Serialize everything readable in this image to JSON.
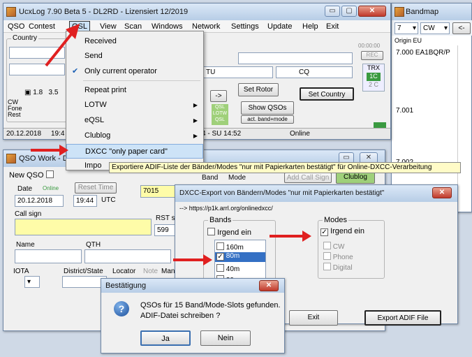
{
  "main": {
    "title": "UcxLog 7.90 Beta 5 - DL2RD - Lizensiert 12/2019",
    "menu": [
      "QSO",
      "Contest",
      "QSL",
      "View",
      "Scan",
      "Windows",
      "Network",
      "Settings",
      "Update",
      "Help",
      "Exit"
    ],
    "country_label": "Country",
    "time": "00:00:00",
    "rec": "REC",
    "trx": "TRX",
    "tu": "TU",
    "cq": "CQ",
    "bands": [
      "1.8",
      "3.5"
    ],
    "mode_rows": [
      "CW",
      "Fone",
      "Rest"
    ],
    "set_rotor": "Set Rotor",
    "set_country": "Set Country",
    "arrow_btn": "->",
    "show_qsos": "Show QSOs",
    "act_band_mode": "act. band+mode",
    "qsl_lotw": [
      "QSL",
      "LOTW",
      "QSL"
    ],
    "date_status": "20.12.2018",
    "time_status": "19:4",
    "sun": "4 - SU 14:52",
    "online": "Online"
  },
  "qsl_menu": {
    "items": [
      {
        "label": "Received",
        "submenu": false,
        "checked": false
      },
      {
        "label": "Send",
        "submenu": false,
        "checked": false
      },
      {
        "label": "Only current operator",
        "submenu": false,
        "checked": true
      },
      {
        "label": "Repeat print",
        "submenu": false,
        "checked": false
      },
      {
        "label": "LOTW",
        "submenu": true,
        "checked": false
      },
      {
        "label": "eQSL",
        "submenu": true,
        "checked": false
      },
      {
        "label": "Clublog",
        "submenu": true,
        "checked": false
      },
      {
        "label": "DXCC \"only paper card\"",
        "submenu": false,
        "checked": false
      },
      {
        "label": "Impo",
        "submenu": false,
        "checked": false
      }
    ]
  },
  "tooltip": "Exportiere ADIF-Liste der Bänder/Modes \"nur mit Papierkarten bestätigt\" für Online-DXCC-Verarbeitung",
  "bandmap": {
    "title": "Bandmap",
    "band": "7",
    "mode": "CW",
    "origin": "Origin EU",
    "arrow": "<-",
    "rows": [
      {
        "freq": "7.000",
        "call": "EA1BQR/P"
      },
      {
        "freq": "7.001",
        "call": ""
      },
      {
        "freq": "7.002",
        "call": ""
      }
    ]
  },
  "qso": {
    "title": "QSO Work - D",
    "new_qso": "New QSO",
    "date_label": "Date",
    "online_label": "Online",
    "reset_time": "Reset Time",
    "date": "20.12.2018",
    "time": "19:44",
    "utc": "UTC",
    "freq": "7015",
    "callsign_label": "Call sign",
    "rst_label": "RST s",
    "rst": "599",
    "name_label": "Name",
    "qth_label": "QTH",
    "iota_label": "IOTA",
    "district_label": "District/State",
    "locator_label": "Locator",
    "note": "Note",
    "man": "Man",
    "band_label": "Band",
    "mode_label": "Mode",
    "add_call": "Add Call Sign",
    "clublog": "Clublog"
  },
  "dxcc": {
    "title": "DXCC-Export von Bändern/Modes \"nur mit Papierkarten bestätigt\"",
    "url": "--> https://p1k.arrl.org/onlinedxcc/",
    "bands_title": "Bands",
    "any_band": "Irgend ein",
    "band_list": [
      {
        "label": "160m",
        "checked": false,
        "selected": false
      },
      {
        "label": "80m",
        "checked": true,
        "selected": true
      },
      {
        "label": "40m",
        "checked": false,
        "selected": false
      },
      {
        "label": "30m",
        "checked": false,
        "selected": false
      }
    ],
    "modes_title": "Modes",
    "any_mode": "Irgend ein",
    "mode_list": [
      "CW",
      "Phone",
      "Digital"
    ],
    "exit": "Exit",
    "export": "Export ADIF File"
  },
  "confirm": {
    "title": "Bestätigung",
    "icon": "question-icon",
    "line1": "QSOs für 15 Band/Mode-Slots gefunden.",
    "line2": "ADIF-Datei schreiben ?",
    "yes": "Ja",
    "no": "Nein"
  }
}
